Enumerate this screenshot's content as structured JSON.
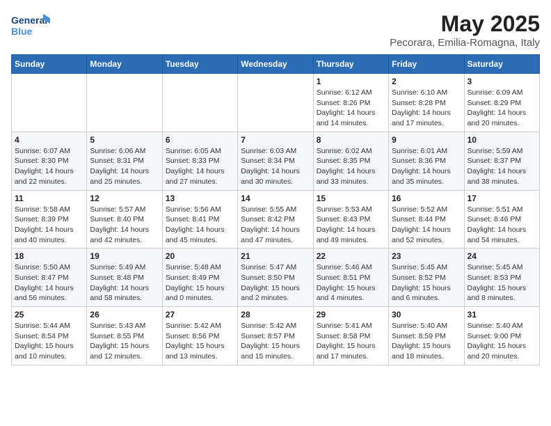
{
  "logo": {
    "line1": "General",
    "line2": "Blue"
  },
  "title": "May 2025",
  "subtitle": "Pecorara, Emilia-Romagna, Italy",
  "weekdays": [
    "Sunday",
    "Monday",
    "Tuesday",
    "Wednesday",
    "Thursday",
    "Friday",
    "Saturday"
  ],
  "weeks": [
    [
      {
        "day": "",
        "info": ""
      },
      {
        "day": "",
        "info": ""
      },
      {
        "day": "",
        "info": ""
      },
      {
        "day": "",
        "info": ""
      },
      {
        "day": "1",
        "info": "Sunrise: 6:12 AM\nSunset: 8:26 PM\nDaylight: 14 hours and 14 minutes."
      },
      {
        "day": "2",
        "info": "Sunrise: 6:10 AM\nSunset: 8:28 PM\nDaylight: 14 hours and 17 minutes."
      },
      {
        "day": "3",
        "info": "Sunrise: 6:09 AM\nSunset: 8:29 PM\nDaylight: 14 hours and 20 minutes."
      }
    ],
    [
      {
        "day": "4",
        "info": "Sunrise: 6:07 AM\nSunset: 8:30 PM\nDaylight: 14 hours and 22 minutes."
      },
      {
        "day": "5",
        "info": "Sunrise: 6:06 AM\nSunset: 8:31 PM\nDaylight: 14 hours and 25 minutes."
      },
      {
        "day": "6",
        "info": "Sunrise: 6:05 AM\nSunset: 8:33 PM\nDaylight: 14 hours and 27 minutes."
      },
      {
        "day": "7",
        "info": "Sunrise: 6:03 AM\nSunset: 8:34 PM\nDaylight: 14 hours and 30 minutes."
      },
      {
        "day": "8",
        "info": "Sunrise: 6:02 AM\nSunset: 8:35 PM\nDaylight: 14 hours and 33 minutes."
      },
      {
        "day": "9",
        "info": "Sunrise: 6:01 AM\nSunset: 8:36 PM\nDaylight: 14 hours and 35 minutes."
      },
      {
        "day": "10",
        "info": "Sunrise: 5:59 AM\nSunset: 8:37 PM\nDaylight: 14 hours and 38 minutes."
      }
    ],
    [
      {
        "day": "11",
        "info": "Sunrise: 5:58 AM\nSunset: 8:39 PM\nDaylight: 14 hours and 40 minutes."
      },
      {
        "day": "12",
        "info": "Sunrise: 5:57 AM\nSunset: 8:40 PM\nDaylight: 14 hours and 42 minutes."
      },
      {
        "day": "13",
        "info": "Sunrise: 5:56 AM\nSunset: 8:41 PM\nDaylight: 14 hours and 45 minutes."
      },
      {
        "day": "14",
        "info": "Sunrise: 5:55 AM\nSunset: 8:42 PM\nDaylight: 14 hours and 47 minutes."
      },
      {
        "day": "15",
        "info": "Sunrise: 5:53 AM\nSunset: 8:43 PM\nDaylight: 14 hours and 49 minutes."
      },
      {
        "day": "16",
        "info": "Sunrise: 5:52 AM\nSunset: 8:44 PM\nDaylight: 14 hours and 52 minutes."
      },
      {
        "day": "17",
        "info": "Sunrise: 5:51 AM\nSunset: 8:46 PM\nDaylight: 14 hours and 54 minutes."
      }
    ],
    [
      {
        "day": "18",
        "info": "Sunrise: 5:50 AM\nSunset: 8:47 PM\nDaylight: 14 hours and 56 minutes."
      },
      {
        "day": "19",
        "info": "Sunrise: 5:49 AM\nSunset: 8:48 PM\nDaylight: 14 hours and 58 minutes."
      },
      {
        "day": "20",
        "info": "Sunrise: 5:48 AM\nSunset: 8:49 PM\nDaylight: 15 hours and 0 minutes."
      },
      {
        "day": "21",
        "info": "Sunrise: 5:47 AM\nSunset: 8:50 PM\nDaylight: 15 hours and 2 minutes."
      },
      {
        "day": "22",
        "info": "Sunrise: 5:46 AM\nSunset: 8:51 PM\nDaylight: 15 hours and 4 minutes."
      },
      {
        "day": "23",
        "info": "Sunrise: 5:45 AM\nSunset: 8:52 PM\nDaylight: 15 hours and 6 minutes."
      },
      {
        "day": "24",
        "info": "Sunrise: 5:45 AM\nSunset: 8:53 PM\nDaylight: 15 hours and 8 minutes."
      }
    ],
    [
      {
        "day": "25",
        "info": "Sunrise: 5:44 AM\nSunset: 8:54 PM\nDaylight: 15 hours and 10 minutes."
      },
      {
        "day": "26",
        "info": "Sunrise: 5:43 AM\nSunset: 8:55 PM\nDaylight: 15 hours and 12 minutes."
      },
      {
        "day": "27",
        "info": "Sunrise: 5:42 AM\nSunset: 8:56 PM\nDaylight: 15 hours and 13 minutes."
      },
      {
        "day": "28",
        "info": "Sunrise: 5:42 AM\nSunset: 8:57 PM\nDaylight: 15 hours and 15 minutes."
      },
      {
        "day": "29",
        "info": "Sunrise: 5:41 AM\nSunset: 8:58 PM\nDaylight: 15 hours and 17 minutes."
      },
      {
        "day": "30",
        "info": "Sunrise: 5:40 AM\nSunset: 8:59 PM\nDaylight: 15 hours and 18 minutes."
      },
      {
        "day": "31",
        "info": "Sunrise: 5:40 AM\nSunset: 9:00 PM\nDaylight: 15 hours and 20 minutes."
      }
    ]
  ]
}
